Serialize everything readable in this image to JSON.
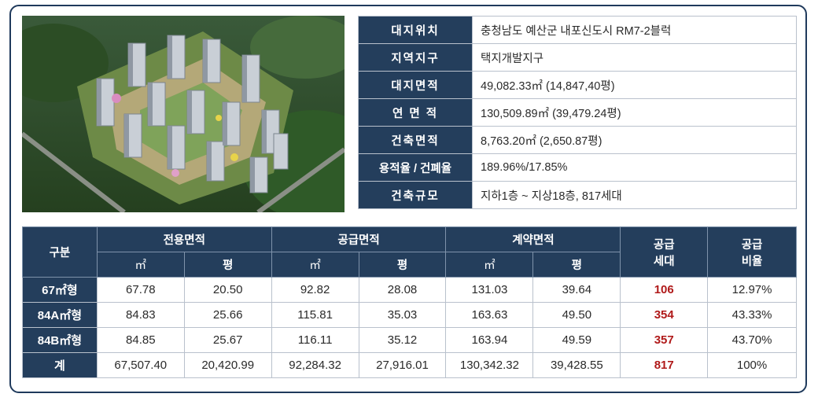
{
  "site_info": [
    {
      "label": "대지위치",
      "value": "충청남도 예산군 내포신도시 RM7-2블럭"
    },
    {
      "label": "지역지구",
      "value": "택지개발지구"
    },
    {
      "label": "대지면적",
      "value": "49,082.33㎡ (14,847,40평)"
    },
    {
      "label": "연 면 적",
      "value": "130,509.89㎡ (39,479.24평)"
    },
    {
      "label": "건축면적",
      "value": "8,763.20㎡ (2,650.87평)"
    },
    {
      "label": "용적율 / 건폐율",
      "value": "189.96%/17.85%"
    },
    {
      "label": "건축규모",
      "value": "지하1층 ~ 지상18층, 817세대"
    }
  ],
  "supply": {
    "headers": {
      "category": "구분",
      "exclusive": "전용면적",
      "supply_area": "공급면적",
      "contract": "계약면적",
      "households": "공급\n세대",
      "ratio": "공급\n비율",
      "sqm": "㎡",
      "pyeong": "평"
    },
    "rows": [
      {
        "type": "67㎡형",
        "ex_m2": "67.78",
        "ex_py": "20.50",
        "sup_m2": "92.82",
        "sup_py": "28.08",
        "con_m2": "131.03",
        "con_py": "39.64",
        "households": "106",
        "ratio": "12.97%"
      },
      {
        "type": "84A㎡형",
        "ex_m2": "84.83",
        "ex_py": "25.66",
        "sup_m2": "115.81",
        "sup_py": "35.03",
        "con_m2": "163.63",
        "con_py": "49.50",
        "households": "354",
        "ratio": "43.33%"
      },
      {
        "type": "84B㎡형",
        "ex_m2": "84.85",
        "ex_py": "25.67",
        "sup_m2": "116.11",
        "sup_py": "35.12",
        "con_m2": "163.94",
        "con_py": "49.59",
        "households": "357",
        "ratio": "43.70%"
      },
      {
        "type": "계",
        "ex_m2": "67,507.40",
        "ex_py": "20,420.99",
        "sup_m2": "92,284.32",
        "sup_py": "27,916.01",
        "con_m2": "130,342.32",
        "con_py": "39,428.55",
        "households": "817",
        "ratio": "100%"
      }
    ]
  },
  "colors": {
    "header": "#243e5c",
    "accent_red": "#b01a1a",
    "border": "#1f3a5c"
  }
}
